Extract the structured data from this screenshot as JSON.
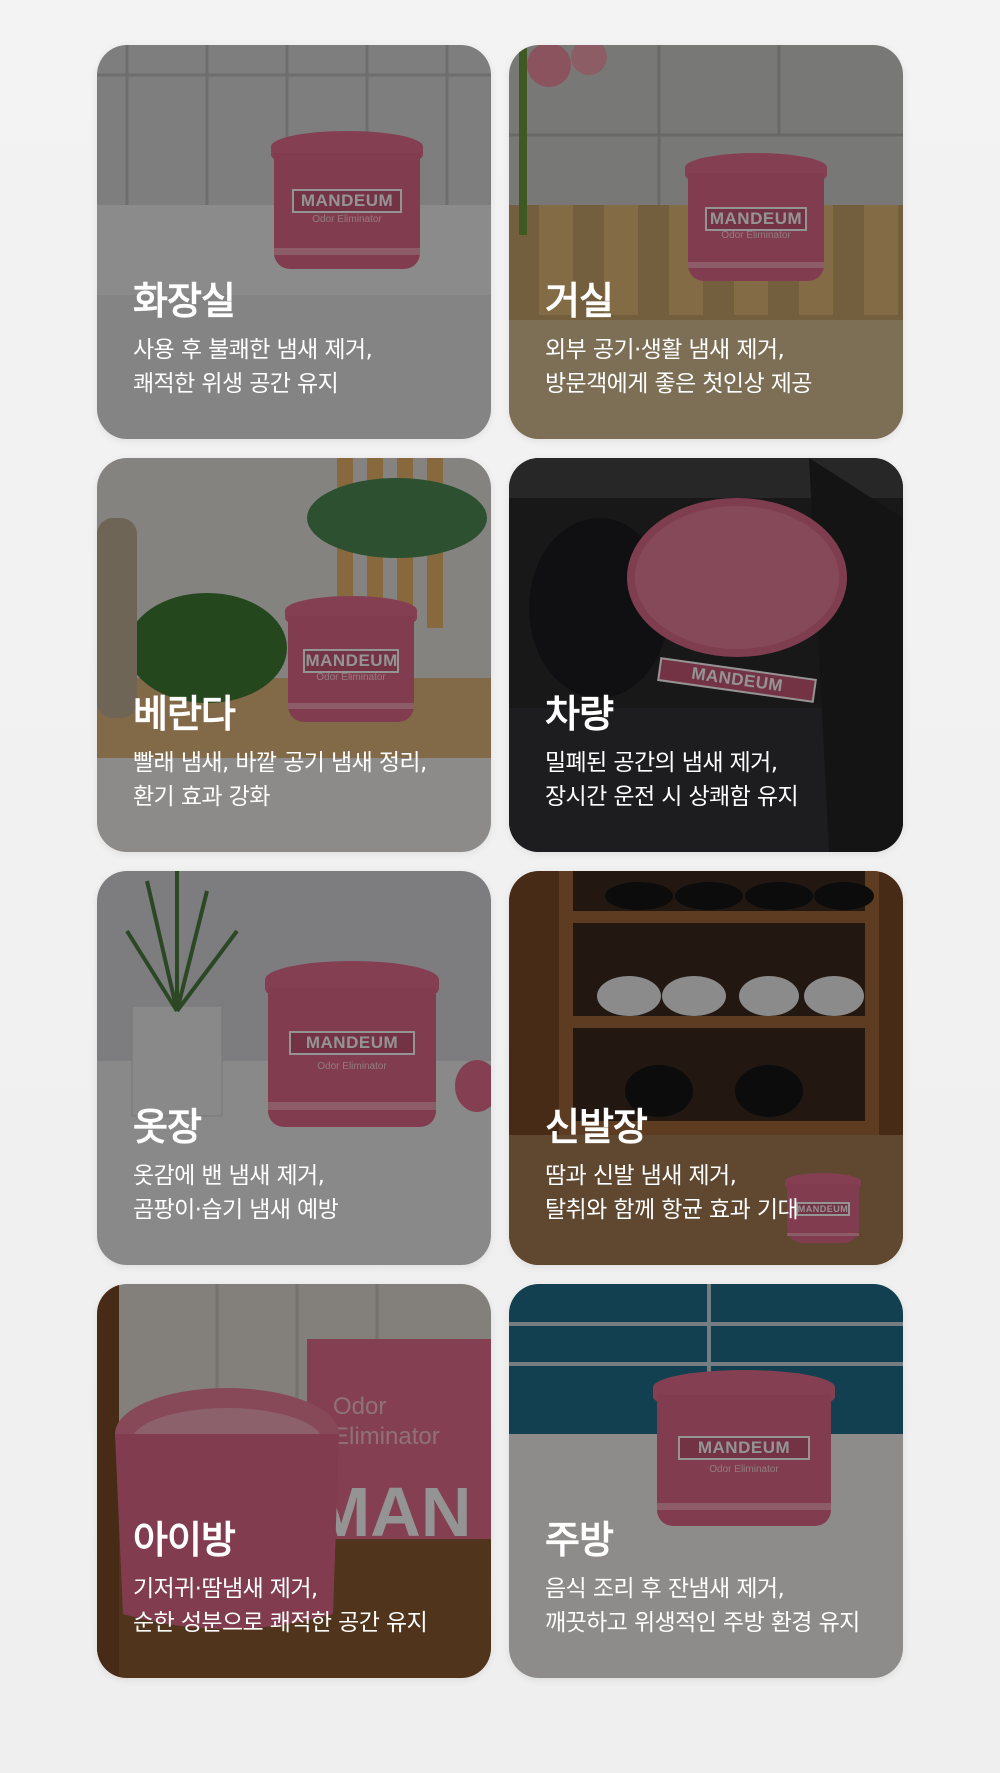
{
  "brand": {
    "jar_label": "MANDEUM",
    "jar_sub": "Odor Eliminator",
    "box_text": "Odor\nEliminator",
    "box_big": "MAN"
  },
  "cards": [
    {
      "title": "화장실",
      "lines": [
        "사용 후 불쾌한 냄새 제거,",
        "쾌적한 위생 공간 유지"
      ]
    },
    {
      "title": "거실",
      "lines": [
        "외부 공기·생활 냄새 제거,",
        "방문객에게 좋은 첫인상 제공"
      ]
    },
    {
      "title": "베란다",
      "lines": [
        "빨래 냄새, 바깥 공기 냄새 정리,",
        "환기 효과 강화"
      ]
    },
    {
      "title": "차량",
      "lines": [
        "밀폐된 공간의 냄새 제거,",
        "장시간 운전 시 상쾌함 유지"
      ]
    },
    {
      "title": "옷장",
      "lines": [
        "옷감에 밴 냄새 제거,",
        "곰팡이·습기 냄새 예방"
      ]
    },
    {
      "title": "신발장",
      "lines": [
        "땀과 신발 냄새 제거,",
        "탈취와 함께 항균 효과 기대"
      ]
    },
    {
      "title": "아이방",
      "lines": [
        "기저귀·땀냄새 제거,",
        "순한 성분으로 쾌적한 공간 유지"
      ]
    },
    {
      "title": "주방",
      "lines": [
        "음식 조리 후 잔냄새 제거,",
        "깨끗하고 위생적인 주방 환경 유지"
      ]
    }
  ],
  "colors": {
    "jar_pink": "#df6a89",
    "overlay": "rgba(0,0,0,0.42)"
  }
}
